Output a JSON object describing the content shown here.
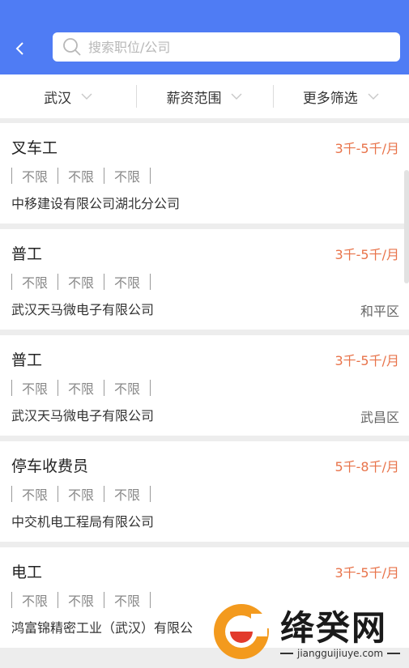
{
  "search": {
    "placeholder": "搜索职位/公司"
  },
  "filters": [
    {
      "label": "武汉"
    },
    {
      "label": "薪资范围"
    },
    {
      "label": "更多筛选"
    }
  ],
  "jobs": [
    {
      "title": "叉车工",
      "salary": "3千-5千/月",
      "tags": [
        "不限",
        "不限",
        "不限"
      ],
      "company": "中移建设有限公司湖北分公司",
      "district": ""
    },
    {
      "title": "普工",
      "salary": "3千-5千/月",
      "tags": [
        "不限",
        "不限",
        "不限"
      ],
      "company": "武汉天马微电子有限公司",
      "district": "和平区"
    },
    {
      "title": "普工",
      "salary": "3千-5千/月",
      "tags": [
        "不限",
        "不限",
        "不限"
      ],
      "company": "武汉天马微电子有限公司",
      "district": "武昌区"
    },
    {
      "title": "停车收费员",
      "salary": "5千-8千/月",
      "tags": [
        "不限",
        "不限",
        "不限"
      ],
      "company": "中交机电工程局有限公司",
      "district": ""
    },
    {
      "title": "电工",
      "salary": "3千-5千/月",
      "tags": [
        "不限",
        "不限",
        "不限"
      ],
      "company": "鸿富锦精密工业（武汉）有限公",
      "district": ""
    }
  ],
  "watermark": {
    "brand": "绛癸网",
    "url": "jiangguijiuye.com"
  },
  "colors": {
    "header": "#4f7cf4",
    "salary": "#e8734a",
    "logo_orange": "#f39a1e"
  }
}
